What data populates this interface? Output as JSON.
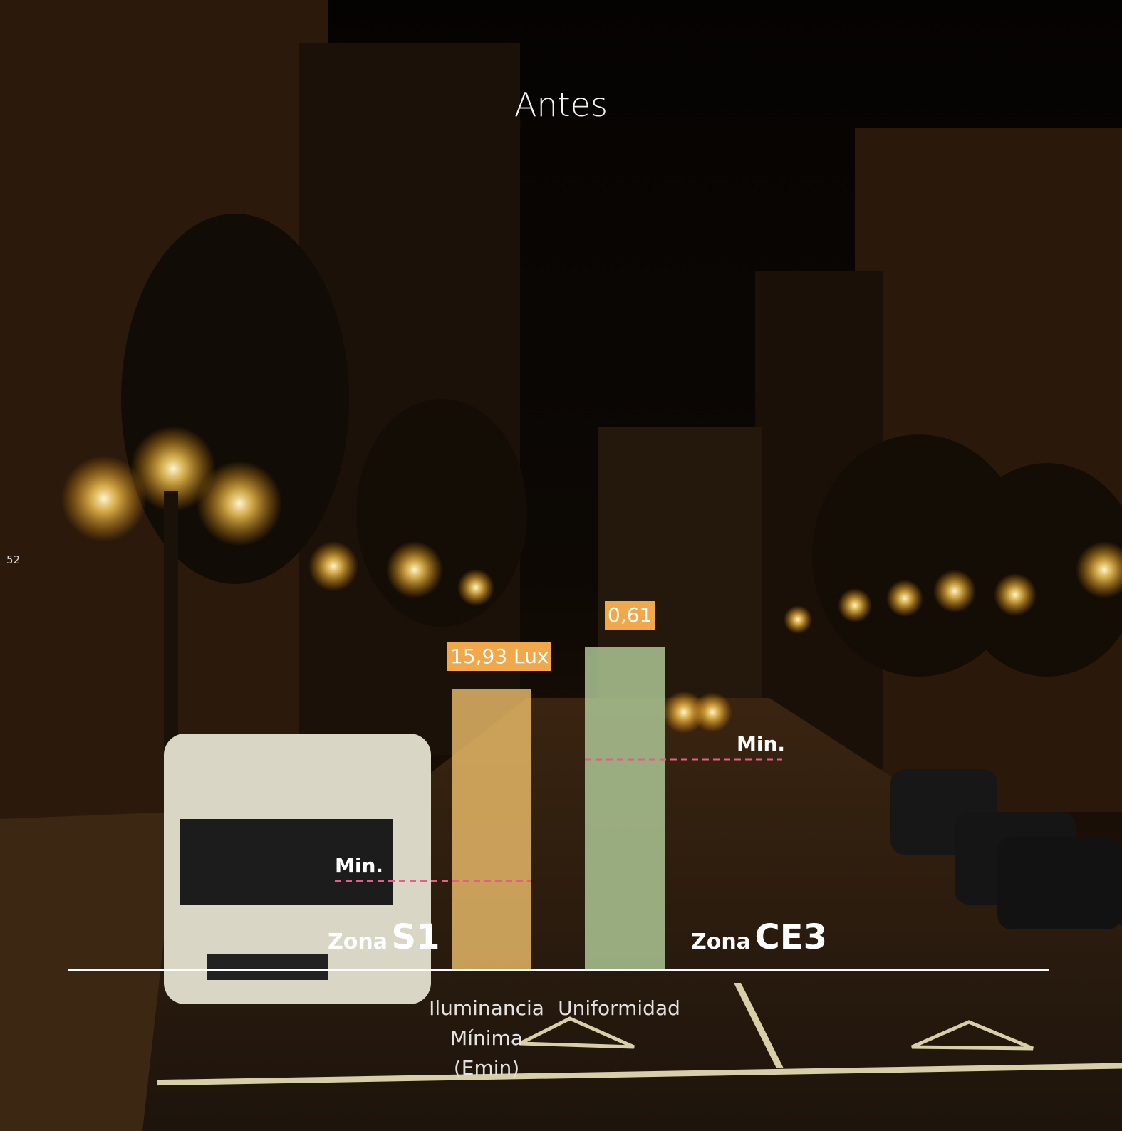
{
  "title": "Antes",
  "page_number": "52",
  "colors": {
    "bar_lux": "#f5c46e",
    "bar_uniformity": "#b7d5a0",
    "value_label_bg": "#f1a84b",
    "min_line": "#ea5b86",
    "baseline": "#ffffff"
  },
  "zones": [
    {
      "prefix": "Zona",
      "code": "S1"
    },
    {
      "prefix": "Zona",
      "code": "CE3"
    }
  ],
  "chart_data": {
    "type": "bar",
    "categories": [
      "Iluminancia Mínima (Emin)",
      "Uniformidad"
    ],
    "category_label_lines": [
      [
        "Iluminancia",
        "Mínima",
        "(Emin)"
      ],
      [
        "Uniformidad"
      ]
    ],
    "values": [
      15.93,
      0.61
    ],
    "value_labels": [
      "15,93 Lux",
      "0,61"
    ],
    "minimum_label": "Min.",
    "title": "Antes",
    "xlabel": "",
    "ylabel": "",
    "grid": false,
    "legend": "none"
  }
}
